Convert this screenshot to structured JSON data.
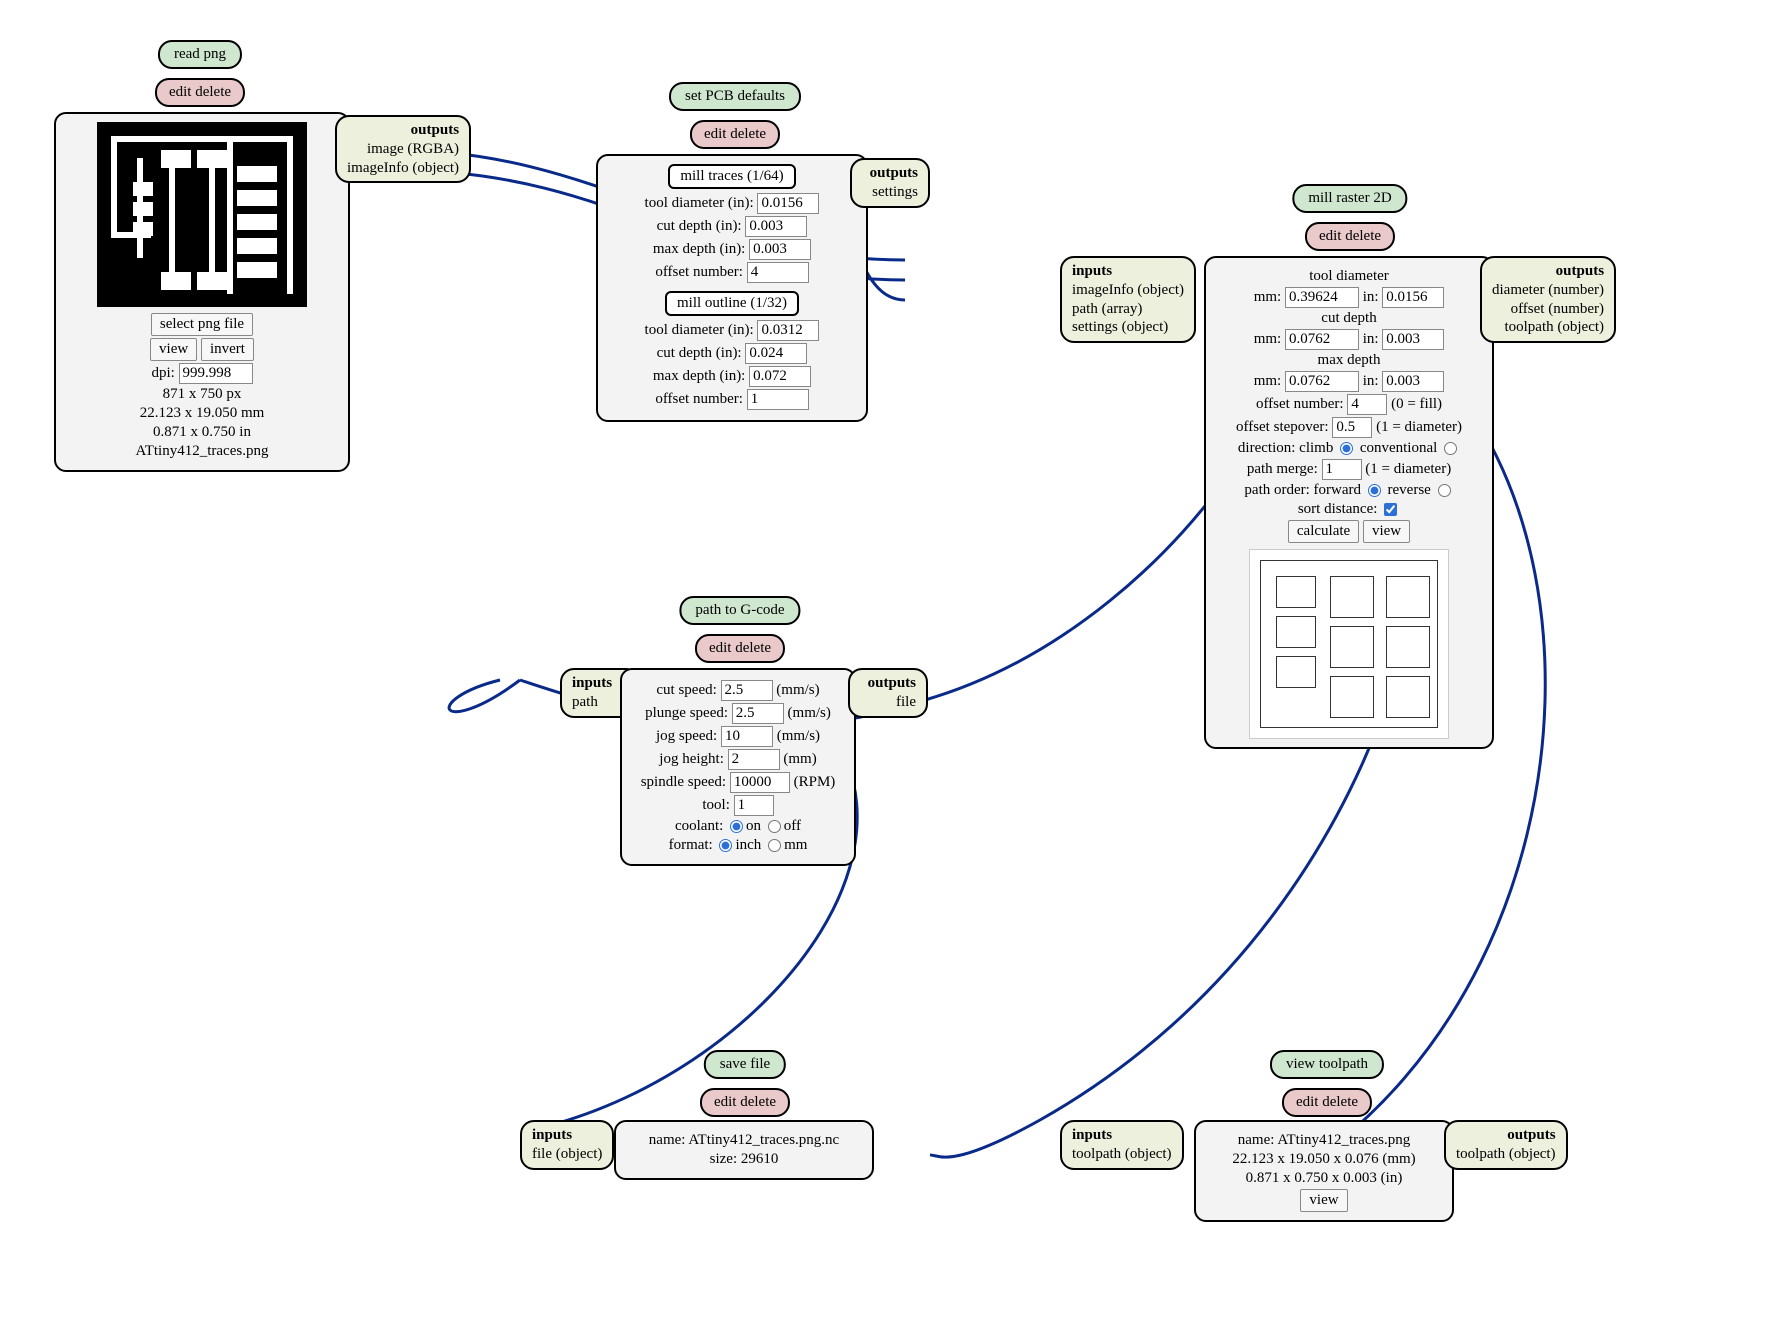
{
  "common": {
    "edit": "edit",
    "delete": "delete",
    "inputs": "inputs",
    "outputs": "outputs"
  },
  "readPng": {
    "title": "read png",
    "selectBtn": "select png file",
    "viewBtn": "view",
    "invertBtn": "invert",
    "dpiLabel": "dpi:",
    "dpi": "999.998",
    "dimsPx": "871 x 750 px",
    "dimsMm": "22.123 x 19.050 mm",
    "dimsIn": "0.871 x 0.750 in",
    "filename": "ATtiny412_traces.png",
    "out1": "image (RGBA)",
    "out2": "imageInfo (object)"
  },
  "pcbDefaults": {
    "title": "set PCB defaults",
    "tracesBtn": "mill traces (1/64)",
    "outlineBtn": "mill outline (1/32)",
    "toolDiaLabel": "tool diameter (in):",
    "cutDepthLabel": "cut depth (in):",
    "maxDepthLabel": "max depth (in):",
    "offsetNumLabel": "offset number:",
    "traces": {
      "toolDia": "0.0156",
      "cutDepth": "0.003",
      "maxDepth": "0.003",
      "offsetNum": "4"
    },
    "outline": {
      "toolDia": "0.0312",
      "cutDepth": "0.024",
      "maxDepth": "0.072",
      "offsetNum": "1"
    },
    "out": "settings"
  },
  "millRaster": {
    "title": "mill raster 2D",
    "toolDiaLabel": "tool diameter",
    "cutDepthLabel": "cut depth",
    "maxDepthLabel": "max depth",
    "mmLabel": "mm:",
    "inLabel": "in:",
    "toolDia_mm": "0.39624",
    "toolDia_in": "0.0156",
    "cutDepth_mm": "0.0762",
    "cutDepth_in": "0.003",
    "maxDepth_mm": "0.0762",
    "maxDepth_in": "0.003",
    "offsetNumLabel": "offset number:",
    "offsetNum": "4",
    "offsetNumHint": "(0 = fill)",
    "offsetStepLabel": "offset stepover:",
    "offsetStep": "0.5",
    "offsetStepHint": "(1 = diameter)",
    "directionLabel": "direction:",
    "dirClimb": "climb",
    "dirConv": "conventional",
    "pathMergeLabel": "path merge:",
    "pathMerge": "1",
    "pathMergeHint": "(1 = diameter)",
    "pathOrderLabel": "path order:",
    "orderFwd": "forward",
    "orderRev": "reverse",
    "sortLabel": "sort distance:",
    "calcBtn": "calculate",
    "viewBtn": "view",
    "in1": "imageInfo (object)",
    "in2": "path (array)",
    "in3": "settings (object)",
    "out1": "diameter (number)",
    "out2": "offset (number)",
    "out3": "toolpath (object)"
  },
  "gcode": {
    "title": "path to G-code",
    "cutSpeedLabel": "cut speed:",
    "cutSpeed": "2.5",
    "cutSpeedUnit": "(mm/s)",
    "plungeSpeedLabel": "plunge speed:",
    "plungeSpeed": "2.5",
    "plungeSpeedUnit": "(mm/s)",
    "jogSpeedLabel": "jog speed:",
    "jogSpeed": "10",
    "jogSpeedUnit": "(mm/s)",
    "jogHeightLabel": "jog height:",
    "jogHeight": "2",
    "jogHeightUnit": "(mm)",
    "spindleLabel": "spindle speed:",
    "spindle": "10000",
    "spindleUnit": "(RPM)",
    "toolLabel": "tool:",
    "tool": "1",
    "coolantLabel": "coolant:",
    "on": "on",
    "off": "off",
    "formatLabel": "format:",
    "inch": "inch",
    "mm": "mm",
    "in": "path",
    "out": "file"
  },
  "saveFile": {
    "title": "save file",
    "nameLabel": "name:",
    "name": "ATtiny412_traces.png.nc",
    "sizeLabel": "size:",
    "size": "29610",
    "in": "file (object)"
  },
  "viewToolpath": {
    "title": "view toolpath",
    "nameLabel": "name:",
    "name": "ATtiny412_traces.png",
    "dimsMm": "22.123 x 19.050 x 0.076 (mm)",
    "dimsIn": "0.871 x 0.750 x 0.003 (in)",
    "viewBtn": "view",
    "in": "toolpath (object)",
    "out": "toolpath (object)"
  }
}
